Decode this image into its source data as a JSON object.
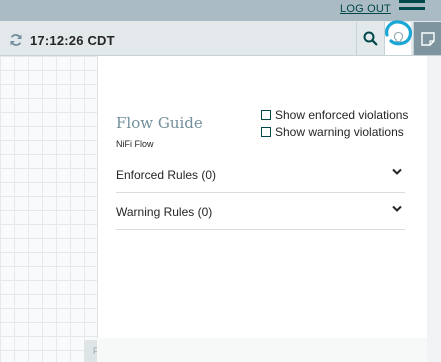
{
  "header": {
    "logout_label": "LOG OUT"
  },
  "toolbar": {
    "refresh_time": "17:12:26 CDT",
    "icons": [
      "refresh-icon",
      "search-icon",
      "lightbulb-icon",
      "notes-icon"
    ]
  },
  "canvas": {
    "label": "PG"
  },
  "flow_guide": {
    "title": "Flow Guide",
    "subtitle": "NiFi Flow",
    "options": [
      {
        "label": "Show enforced violations",
        "checked": false
      },
      {
        "label": "Show warning violations",
        "checked": false
      }
    ],
    "sections": [
      {
        "label": "Enforced Rules (0)"
      },
      {
        "label": "Warning Rules (0)"
      }
    ]
  },
  "colors": {
    "header_bg": "#aabbc3",
    "toolbar_bg": "#e3e8eb",
    "accent_dark": "#004849",
    "title_color": "#728e9b",
    "annotation_blue": "#1aa7d6"
  }
}
